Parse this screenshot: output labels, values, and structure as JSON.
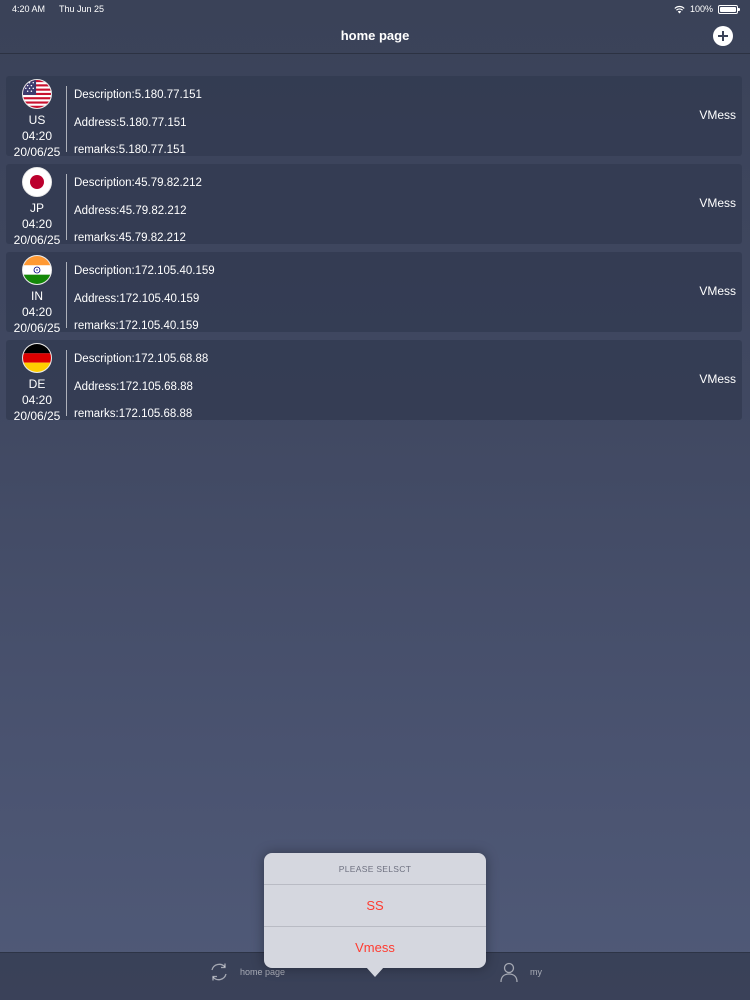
{
  "status_bar": {
    "time": "4:20 AM",
    "date": "Thu Jun 25",
    "battery": "100%",
    "battery_level": 1.0
  },
  "nav": {
    "title": "home page",
    "add_icon": "plus-circle-icon"
  },
  "servers": [
    {
      "country": "US",
      "flag_icon": "us-flag-icon",
      "time": "04:20",
      "date": "20/06/25",
      "description": "Description:5.180.77.151",
      "address": "Address:5.180.77.151",
      "remarks": "remarks:5.180.77.151",
      "protocol": "VMess"
    },
    {
      "country": "JP",
      "flag_icon": "jp-flag-icon",
      "time": "04:20",
      "date": "20/06/25",
      "description": "Description:45.79.82.212",
      "address": "Address:45.79.82.212",
      "remarks": "remarks:45.79.82.212",
      "protocol": "VMess"
    },
    {
      "country": "IN",
      "flag_icon": "in-flag-icon",
      "time": "04:20",
      "date": "20/06/25",
      "description": "Description:172.105.40.159",
      "address": "Address:172.105.40.159",
      "remarks": "remarks:172.105.40.159",
      "protocol": "VMess"
    },
    {
      "country": "DE",
      "flag_icon": "de-flag-icon",
      "time": "04:20",
      "date": "20/06/25",
      "description": "Description:172.105.68.88",
      "address": "Address:172.105.68.88",
      "remarks": "remarks:172.105.68.88",
      "protocol": "VMess"
    }
  ],
  "popover": {
    "title": "PLEASE SELSCT",
    "options": [
      "SS",
      "Vmess"
    ],
    "option_color": "#ff3b30"
  },
  "tab_bar": {
    "home_label": "home page",
    "home_icon": "refresh-icon",
    "my_label": "my",
    "my_icon": "person-icon"
  }
}
